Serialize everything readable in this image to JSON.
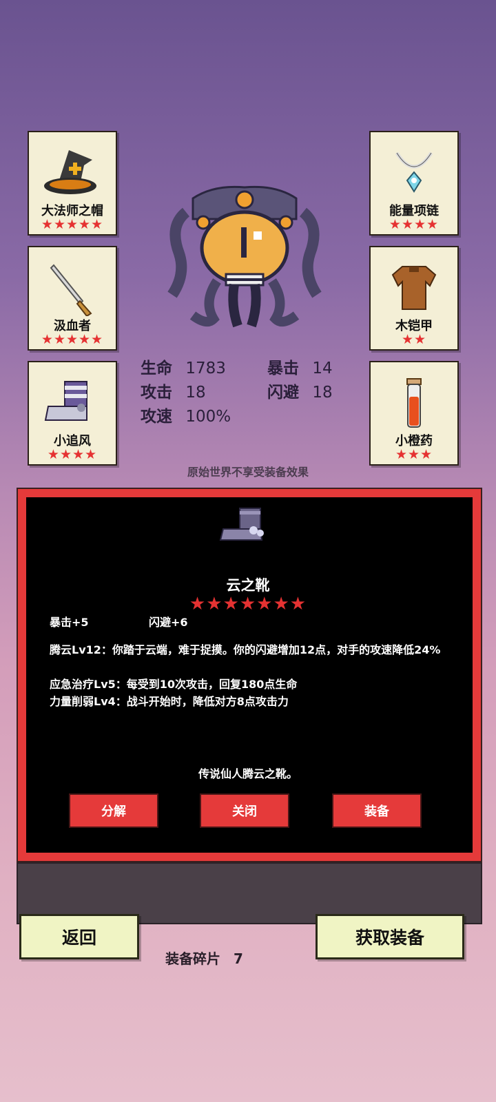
{
  "equipment_slots": [
    {
      "name": "大法师之帽",
      "stars": "★★★★★",
      "icon": "wizard-hat-icon"
    },
    {
      "name": "汲血者",
      "stars": "★★★★★",
      "icon": "dagger-icon"
    },
    {
      "name": "小追风",
      "stars": "★★★★",
      "icon": "boot-icon"
    },
    {
      "name": "能量项链",
      "stars": "★★★★",
      "icon": "necklace-icon"
    },
    {
      "name": "木铠甲",
      "stars": "★★",
      "icon": "wooden-armor-icon"
    },
    {
      "name": "小橙药",
      "stars": "★★★",
      "icon": "potion-icon"
    }
  ],
  "stats": {
    "hp_label": "生命",
    "hp": "1783",
    "crit_label": "暴击",
    "crit": "14",
    "atk_label": "攻击",
    "atk": "18",
    "dodge_label": "闪避",
    "dodge": "18",
    "speed_label": "攻速",
    "speed": "100%"
  },
  "note": "原始世界不享受装备效果",
  "detail": {
    "name": "云之靴",
    "stars": "★★★★★★★",
    "stat1": "暴击+5",
    "stat2": "闪避+6",
    "skill1": "腾云Lv12：你踏于云端，难于捉摸。你的闪避增加12点，对手的攻速降低24%",
    "skill2": "应急治疗Lv5：每受到10次攻击，回复180点生命",
    "skill3": "力量削弱Lv4：战斗开始时，降低对方8点攻击力",
    "flavor": "传说仙人腾云之靴。",
    "btn_decompose": "分解",
    "btn_close": "关闭",
    "btn_equip": "装备"
  },
  "bottom": {
    "back": "返回",
    "shards_label": "装备碎片",
    "shards": "7",
    "get": "获取装备"
  },
  "colors": {
    "accent_red": "#e53a3a",
    "star_red": "#e53232",
    "card_bg": "#f4efd6",
    "button_bg": "#f0f4c4"
  }
}
